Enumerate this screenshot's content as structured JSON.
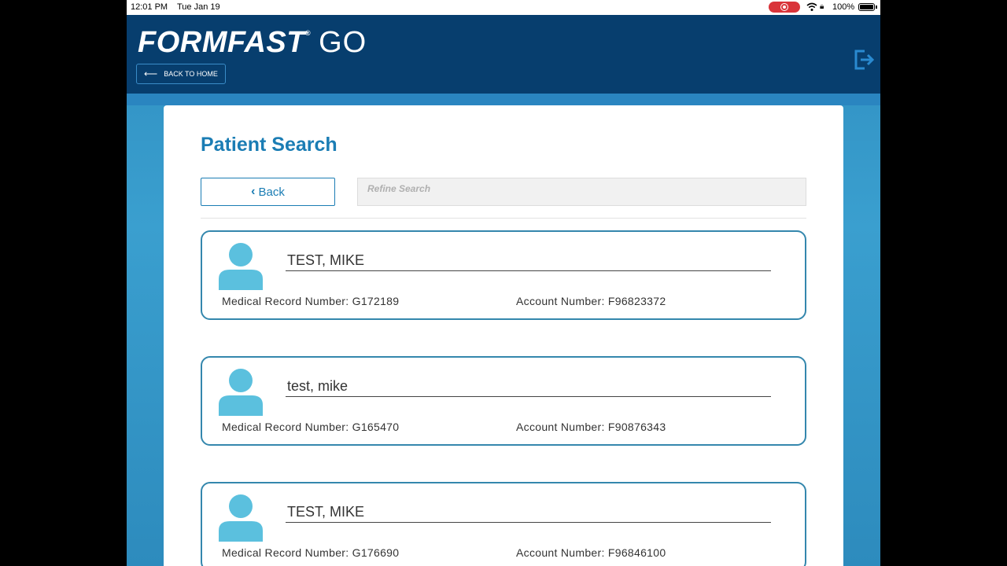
{
  "status_bar": {
    "time": "12:01 PM",
    "date": "Tue Jan 19",
    "battery": "100%",
    "icons": [
      "record-icon",
      "wifi-icon",
      "orientation-lock-icon",
      "battery-icon"
    ]
  },
  "header": {
    "logo_main": "FORMFAST",
    "logo_reg": "®",
    "logo_go": "GO",
    "back_home_label": "BACK TO HOME",
    "logout_icon": "logout-icon"
  },
  "page": {
    "title": "Patient Search",
    "back_label": "Back",
    "search_placeholder": "Refine Search"
  },
  "patients": [
    {
      "name": "TEST, MIKE",
      "mrn_label": "Medical Record Number:",
      "mrn": "G172189",
      "acct_label": "Account Number:",
      "acct": "F96823372"
    },
    {
      "name": "test, mike",
      "mrn_label": "Medical Record Number:",
      "mrn": "G165470",
      "acct_label": "Account Number:",
      "acct": "F90876343"
    },
    {
      "name": "TEST, MIKE",
      "mrn_label": "Medical Record Number:",
      "mrn": "G176690",
      "acct_label": "Account Number:",
      "acct": "F96846100"
    }
  ],
  "colors": {
    "header_bg": "#073e6e",
    "accent": "#1b7db4",
    "card_border": "#3487ad",
    "avatar": "#5bc0de",
    "record": "#d9343a"
  }
}
